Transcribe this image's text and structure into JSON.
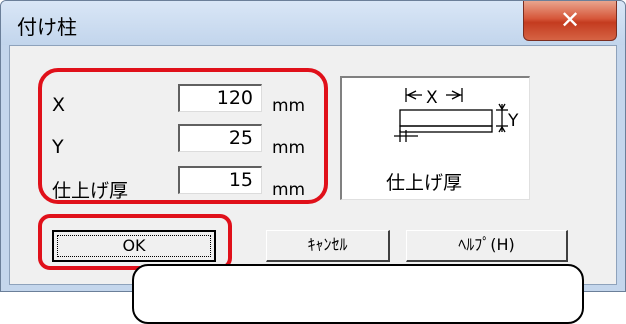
{
  "window": {
    "title": "付け柱",
    "close_glyph": "✕"
  },
  "fields": {
    "x": {
      "label": "X",
      "value": "120",
      "unit": "mm"
    },
    "y": {
      "label": "Y",
      "value": "25",
      "unit": "mm"
    },
    "thickness": {
      "label": "仕上げ厚",
      "value": "15",
      "unit": "mm"
    }
  },
  "diagram": {
    "x_label": "X",
    "y_label": "Y",
    "caption": "仕上げ厚"
  },
  "buttons": {
    "ok": "OK",
    "cancel": "ｷｬﾝｾﾙ",
    "help": "ﾍﾙﾌﾟ(H)"
  },
  "colors": {
    "highlight": "#e0101a",
    "close_button": "#c43b1f",
    "title_bar": "#c4d6ec"
  }
}
